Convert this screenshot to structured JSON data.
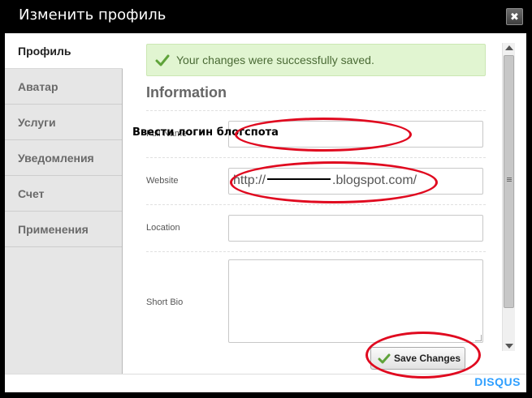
{
  "window": {
    "title": "Изменить профиль",
    "close_symbol": "✖"
  },
  "sidebar": {
    "items": [
      {
        "label": "Профиль",
        "active": true
      },
      {
        "label": "Аватар",
        "active": false
      },
      {
        "label": "Услуги",
        "active": false
      },
      {
        "label": "Уведомления",
        "active": false
      },
      {
        "label": "Счет",
        "active": false
      },
      {
        "label": "Применения",
        "active": false
      }
    ]
  },
  "notification": {
    "text": "Your changes were successfully saved.",
    "icon": "check-icon",
    "color": "#e1f5d1"
  },
  "form": {
    "section_title": "Information",
    "fields": {
      "full_name": {
        "label": "Full Name",
        "value": "Ввести логин блогспота"
      },
      "website": {
        "label": "Website",
        "prefix": "http://",
        "suffix": ".blogspot.com/"
      },
      "location": {
        "label": "Location",
        "value": ""
      },
      "short_bio": {
        "label": "Short Bio",
        "value": ""
      }
    },
    "save_label": "Save Changes"
  },
  "footer": {
    "brand_pre": "DISQ",
    "brand_u": "U",
    "brand_post": "S"
  },
  "colors": {
    "annotation": "#e0091f",
    "accent": "#2e9fff"
  }
}
